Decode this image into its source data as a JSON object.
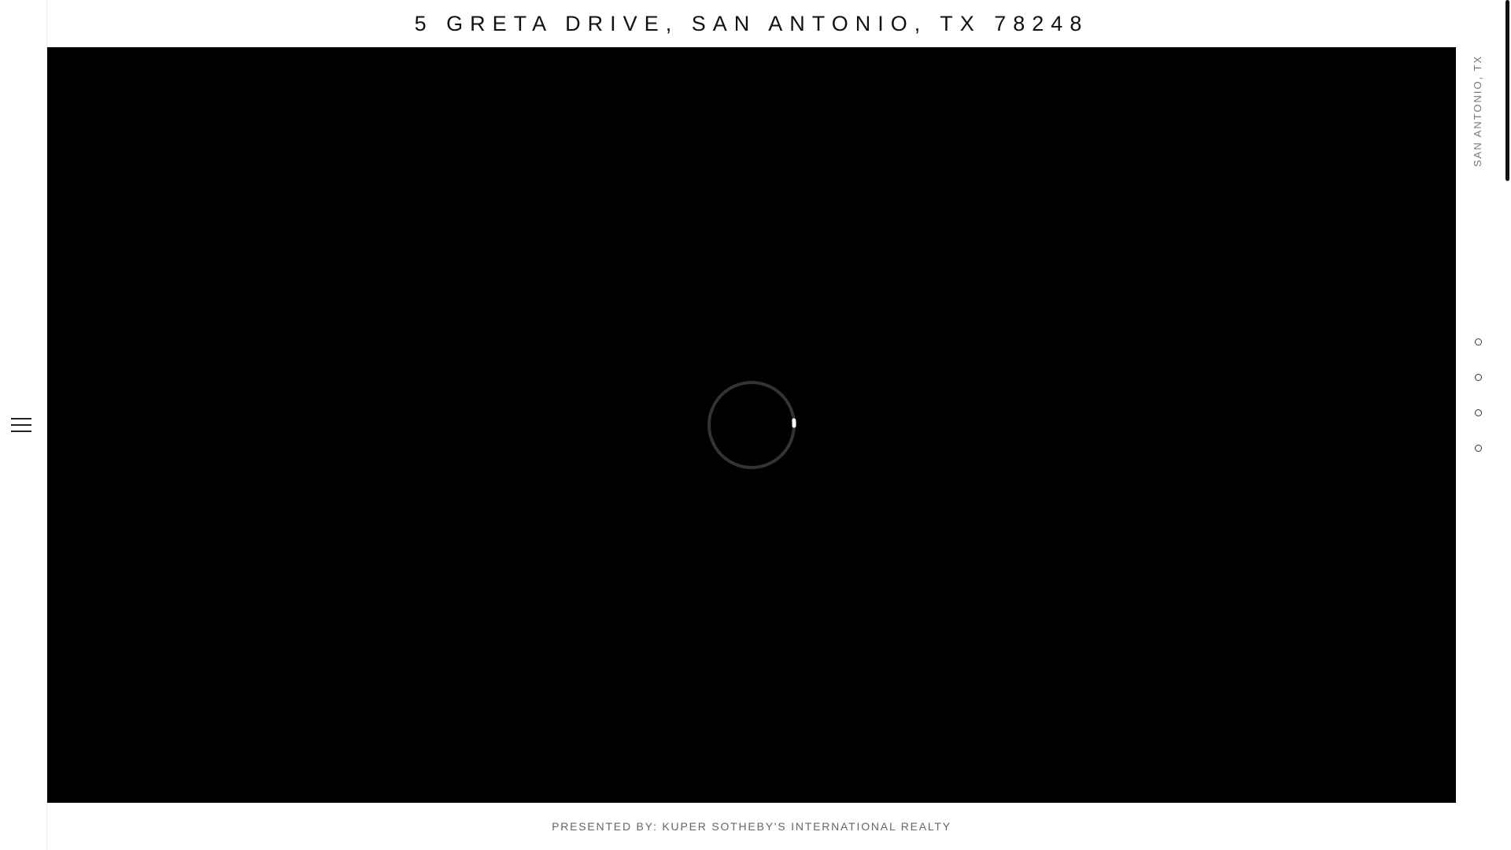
{
  "header": {
    "title": "5 GRETA DRIVE, SAN ANTONIO, TX 78248"
  },
  "sidebar": {
    "menu_icon": "hamburger-menu-icon"
  },
  "media": {
    "background_color": "#000000",
    "loading_icon": "loading-spinner-icon"
  },
  "right_rail": {
    "location_label": "SAN ANTONIO, TX",
    "slide_dots": [
      {
        "icon": "slide-dot-icon"
      },
      {
        "icon": "slide-dot-icon"
      },
      {
        "icon": "slide-dot-icon"
      },
      {
        "icon": "slide-dot-icon"
      }
    ]
  },
  "footer": {
    "presented_by": "PRESENTED BY: KUPER SOTHEBY'S INTERNATIONAL REALTY"
  }
}
